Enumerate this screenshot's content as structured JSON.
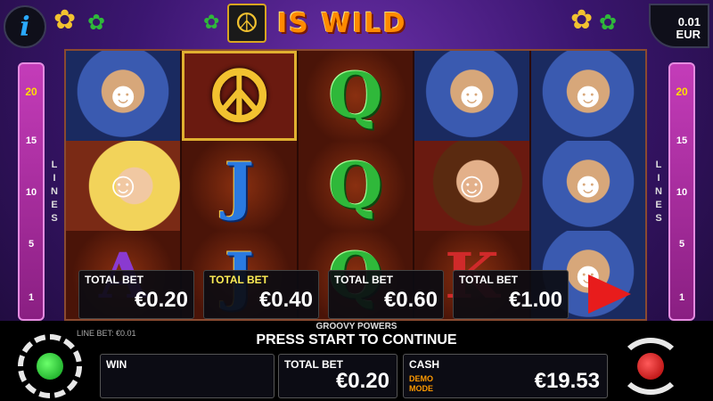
{
  "header": {
    "info_label": "i",
    "title": "IS WILD",
    "denomination": "0.01",
    "currency": "EUR"
  },
  "lines": {
    "label": "LINES",
    "values": [
      "20",
      "15",
      "10",
      "5",
      "1"
    ],
    "active": "20"
  },
  "reels": [
    [
      "face",
      "blonde",
      "letter-a"
    ],
    [
      "peace",
      "letter-j",
      "letter-j"
    ],
    [
      "letter-q",
      "letter-q",
      "letter-q"
    ],
    [
      "face",
      "geek",
      "letter-k"
    ],
    [
      "face",
      "face",
      "face"
    ]
  ],
  "bet_selector": {
    "options": [
      {
        "label": "TOTAL BET",
        "value": "€0.20"
      },
      {
        "label": "TOTAL BET",
        "value": "€0.40"
      },
      {
        "label": "TOTAL BET",
        "value": "€0.60"
      },
      {
        "label": "TOTAL BET",
        "value": "€1.00"
      }
    ],
    "selected_index": 1
  },
  "bottom": {
    "feature_name": "GROOVY POWERS",
    "line_bet": "LINE BET: €0.01",
    "message": "PRESS START TO CONTINUE",
    "win_label": "WIN",
    "win_value": "",
    "total_bet_label": "TOTAL BET",
    "total_bet_value": "€0.20",
    "cash_label": "CASH",
    "cash_value": "€19.53",
    "demo_line1": "DEMO",
    "demo_line2": "MODE"
  },
  "colors": {
    "accent_yellow": "#ffee55",
    "play_red": "#e81c1c",
    "settings_green": "#0a9a1a",
    "lines_pink": "#c43cb9"
  }
}
